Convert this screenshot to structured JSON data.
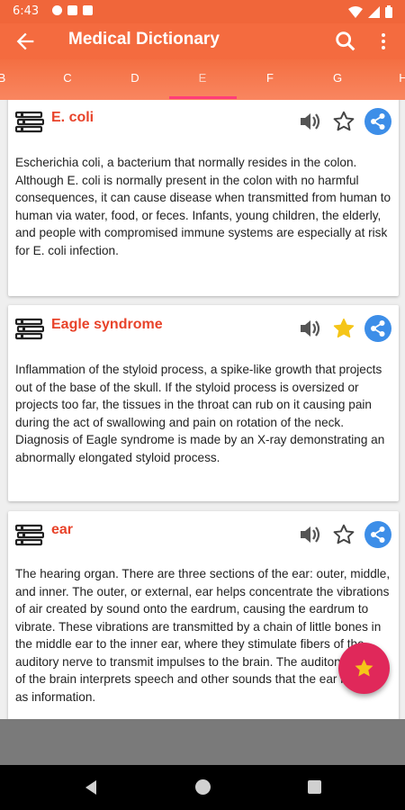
{
  "status_bar": {
    "time": "6:43"
  },
  "app_bar": {
    "title": "Medical Dictionary"
  },
  "tabs": [
    "B",
    "C",
    "D",
    "E",
    "F",
    "G",
    "H"
  ],
  "active_tab": "E",
  "entries": [
    {
      "term": "E. coli",
      "starred": false,
      "definition": "Escherichia coli, a bacterium that normally resides in the colon. Although E. coli is normally present in the colon with no harmful consequences, it can cause disease when transmitted from human to human via water, food, or feces. Infants, young children, the elderly, and people with compromised immune systems are especially at risk for E. coli infection."
    },
    {
      "term": "Eagle syndrome",
      "starred": true,
      "definition": "Inflammation of the styloid process, a spike-like growth that projects out of the base of the skull. If the styloid process is oversized or projects too far, the tissues in the throat can rub on it causing pain during the act of swallowing and pain on rotation of the neck. Diagnosis of Eagle syndrome is made by an X-ray demonstrating an abnormally elongated styloid process."
    },
    {
      "term": "ear",
      "starred": false,
      "definition": "The hearing organ. There are three sections of the ear: outer, middle, and inner. The outer, or external, ear helps concentrate the vibrations of air created by sound onto the eardrum, causing the eardrum to vibrate. These vibrations are transmitted by a chain of little bones in the middle ear to the inner ear, where they stimulate fibers of the auditory nerve to transmit impulses to the brain. The auditory cortex of the brain interprets speech and other sounds that the ear receives as information."
    }
  ],
  "colors": {
    "app_bar": "#f46b3f",
    "term": "#e8432a",
    "share": "#3d8ee8",
    "star_active": "#f5c518",
    "fab": "#e0285a",
    "tab_indicator": "#ff3d7a"
  },
  "icons": {
    "entry_icon": "book-stack-icon",
    "pronounce": "speaker-icon",
    "favorite": "star-icon",
    "share": "share-icon",
    "fab": "star-icon"
  }
}
